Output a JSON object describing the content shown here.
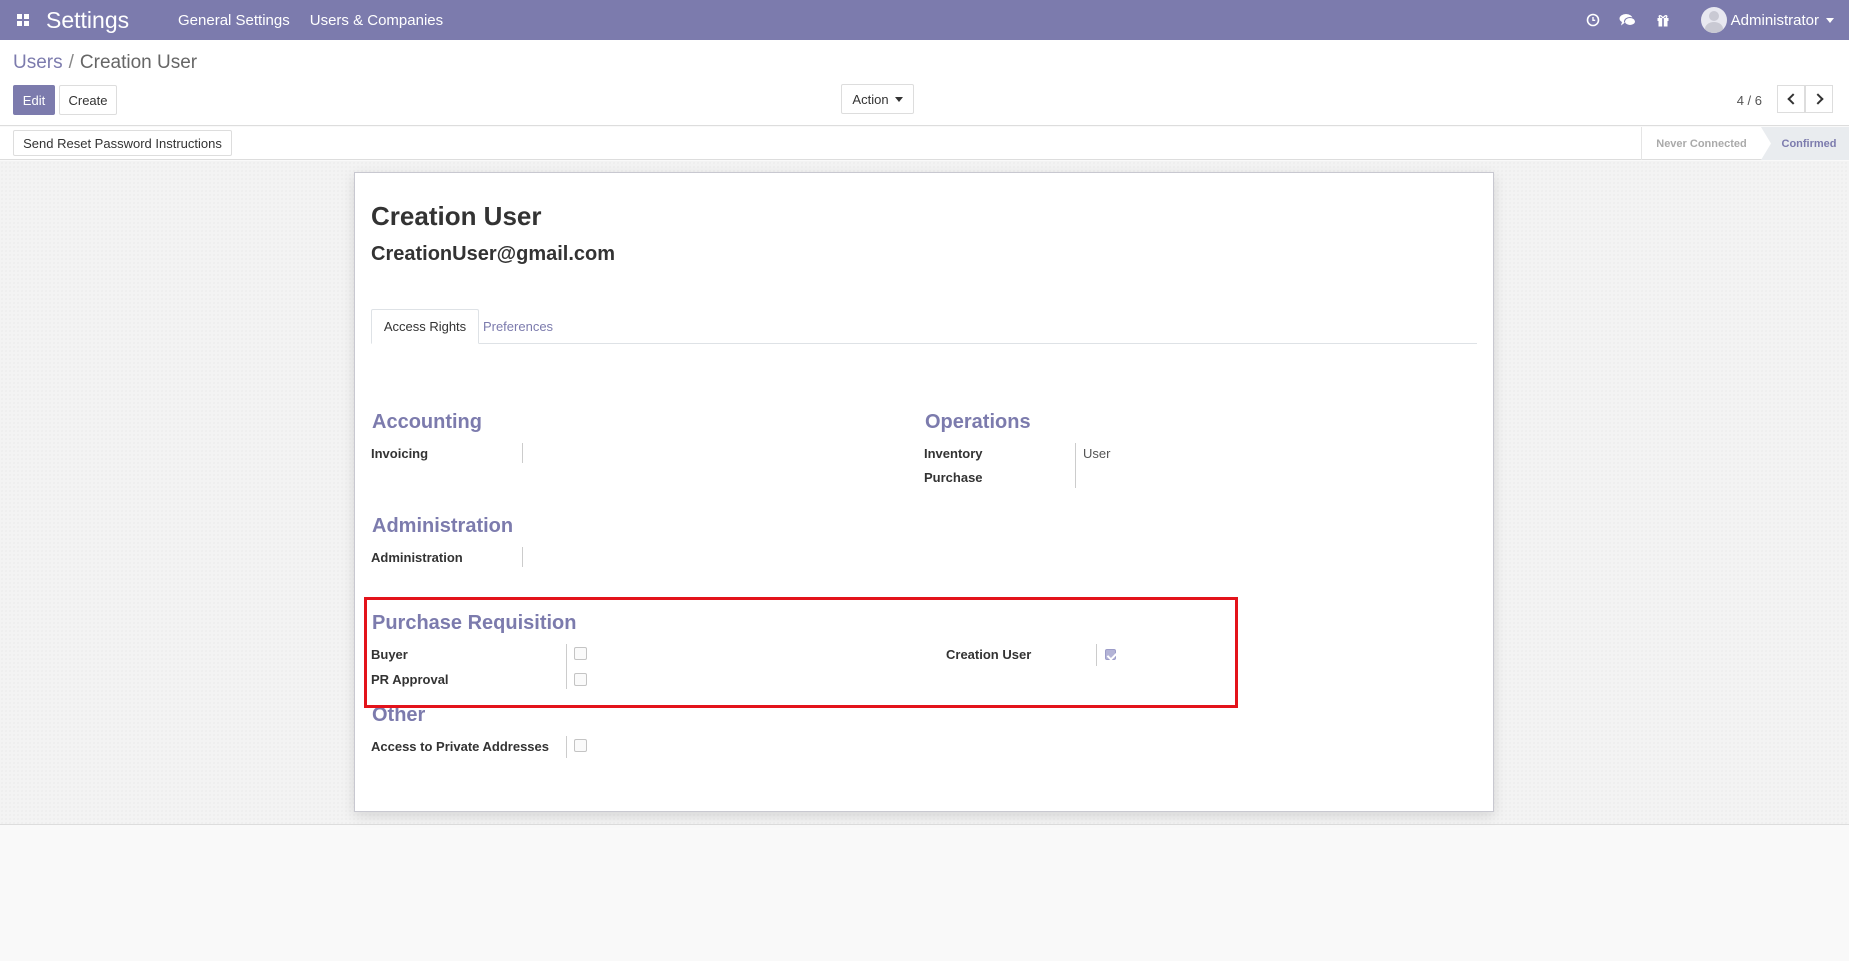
{
  "navbar": {
    "app_title": "Settings",
    "menu": [
      "General Settings",
      "Users & Companies"
    ],
    "user_name": "Administrator",
    "icons": [
      "apps-icon",
      "clock-icon",
      "chat-icon",
      "gift-icon"
    ]
  },
  "control_panel": {
    "breadcrumb_parent": "Users",
    "breadcrumb_current": "Creation User",
    "edit_label": "Edit",
    "create_label": "Create",
    "action_label": "Action",
    "pager_value": "4 / 6"
  },
  "statusbar": {
    "reset_password_label": "Send Reset Password Instructions",
    "stages": [
      "Never Connected",
      "Confirmed"
    ],
    "active_stage": "Confirmed"
  },
  "record": {
    "name": "Creation User",
    "email": "CreationUser@gmail.com"
  },
  "tabs": [
    "Access Rights",
    "Preferences"
  ],
  "groups": {
    "accounting": {
      "title": "Accounting",
      "fields": [
        {
          "label": "Invoicing",
          "value": ""
        }
      ]
    },
    "operations": {
      "title": "Operations",
      "fields": [
        {
          "label": "Inventory",
          "value": "User"
        },
        {
          "label": "Purchase",
          "value": ""
        }
      ]
    },
    "administration": {
      "title": "Administration",
      "fields": [
        {
          "label": "Administration",
          "value": ""
        }
      ]
    },
    "purchase_requisition": {
      "title": "Purchase Requisition",
      "fields": [
        {
          "label": "Buyer",
          "checked": false
        },
        {
          "label": "PR Approval",
          "checked": false
        },
        {
          "label": "Creation User",
          "checked": true
        }
      ]
    },
    "other": {
      "title": "Other",
      "fields": [
        {
          "label": "Access to Private Addresses",
          "checked": false
        }
      ]
    }
  },
  "colors": {
    "brand": "#7c7bad",
    "highlight": "#e3131b"
  }
}
